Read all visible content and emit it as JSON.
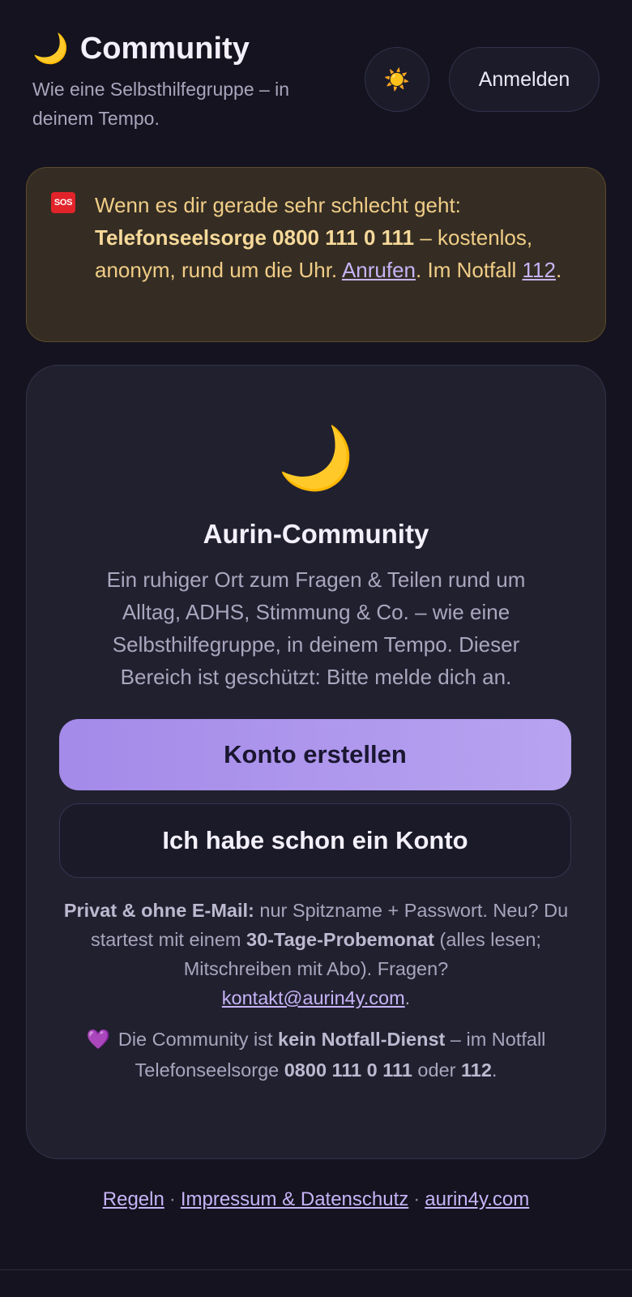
{
  "header": {
    "moon_icon": "🌙",
    "title": "Community",
    "subtitle": "Wie eine Selbsthilfegruppe – in deinem Tempo.",
    "theme_toggle_icon": "☀️",
    "login_label": "Anmelden"
  },
  "sos": {
    "icon_label": "SOS",
    "intro": "Wenn es dir gerade sehr schlecht geht:",
    "hotline": "Telefonseelsorge 0800 111 0 111",
    "details": " – kostenlos, anonym, rund um die Uhr. ",
    "call_link": "Anrufen",
    "emergency_text": ". Im Notfall ",
    "emergency_number": "112",
    "end": "."
  },
  "card": {
    "moon_icon": "🌙",
    "title": "Aurin-Community",
    "description": "Ein ruhiger Ort zum Fragen & Teilen rund um Alltag, ADHS, Stimmung & Co. – wie eine Selbsthilfegruppe, in deinem Tempo. Dieser Bereich ist geschützt: Bitte melde dich an.",
    "primary_button": "Konto erstellen",
    "secondary_button": "Ich habe schon ein Konto",
    "info": {
      "bold1": "Privat & ohne E-Mail:",
      "text1": " nur Spitzname + Passwort. Neu? Du startest mit einem ",
      "bold2": "30-Tage-Probemonat",
      "text2": " (alles lesen; Mitschreiben mit Abo). Fragen? ",
      "email": "kontakt@aurin4y.com",
      "end": "."
    },
    "note": {
      "heart_icon": "💜",
      "text1": "Die Community ist ",
      "bold1": "kein Notfall-Dienst",
      "text2": " – im Notfall Telefonseelsorge ",
      "bold2": "0800 111 0 111",
      "text3": " oder ",
      "bold3": "112",
      "end": "."
    }
  },
  "footer": {
    "links": [
      "Regeln",
      "Impressum & Datenschutz",
      "aurin4y.com"
    ],
    "separator": "·"
  }
}
